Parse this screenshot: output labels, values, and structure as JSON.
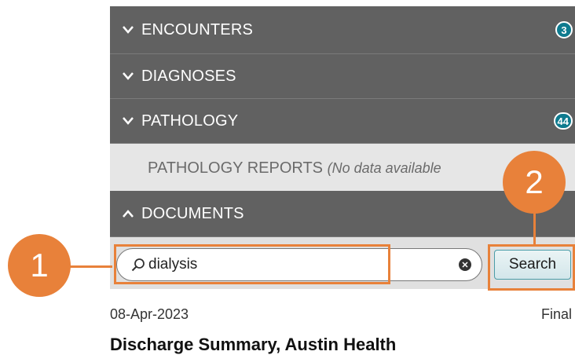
{
  "sections": [
    {
      "label": "ENCOUNTERS",
      "expanded": false,
      "badge": "3"
    },
    {
      "label": "DIAGNOSES",
      "expanded": false,
      "badge": ""
    },
    {
      "label": "PATHOLOGY",
      "expanded": false,
      "badge": "44"
    }
  ],
  "pathology_reports": {
    "label": "PATHOLOGY REPORTS",
    "note": "(No data available"
  },
  "documents": {
    "label": "DOCUMENTS",
    "expanded": true
  },
  "search": {
    "value": "dialysis",
    "button_label": "Search"
  },
  "document_item": {
    "date": "08-Apr-2023",
    "status": "Final",
    "title": "Discharge Summary, Austin Health"
  },
  "callouts": [
    "1",
    "2"
  ],
  "colors": {
    "header_bg": "#616161",
    "badge": "#0f7b8f",
    "callout": "#e8813a",
    "button_border": "#4b9da8"
  }
}
